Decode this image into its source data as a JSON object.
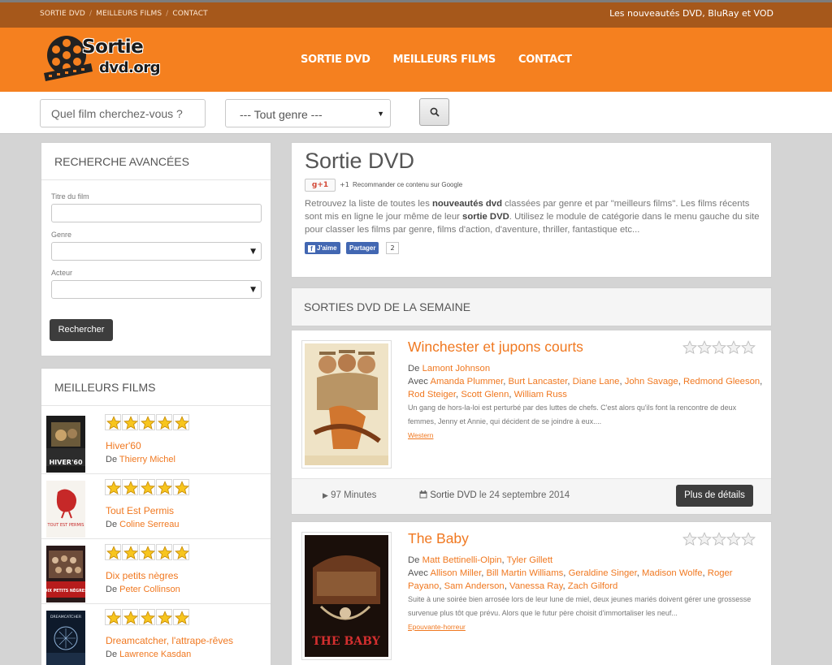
{
  "topbar": {
    "crumbs": [
      "SORTIE DVD",
      "MEILLEURS FILMS",
      "CONTACT"
    ],
    "tagline": "Les nouveautés DVD, BluRay et VOD"
  },
  "logo": {
    "line1": "Sortie",
    "line2": "dvd.org"
  },
  "nav": [
    "SORTIE DVD",
    "MEILLEURS FILMS",
    "CONTACT"
  ],
  "search": {
    "placeholder": "Quel film cherchez-vous ?",
    "genre_value": "--- Tout genre ---"
  },
  "advanced": {
    "title": "RECHERCHE AVANCÉES",
    "title_label": "Titre du film",
    "genre_label": "Genre",
    "actor_label": "Acteur",
    "submit": "Rechercher"
  },
  "best": {
    "title": "MEILLEURS FILMS",
    "items": [
      {
        "title": "Hiver'60",
        "by": "De",
        "director": "Thierry Michel",
        "rating": 5,
        "poster_text": "HIVER'60"
      },
      {
        "title": "Tout Est Permis",
        "by": "De",
        "director": "Coline Serreau",
        "rating": 5,
        "poster_text": "TOUT EST PERMIS"
      },
      {
        "title": "Dix petits nègres",
        "by": "De",
        "director": "Peter Collinson",
        "rating": 5,
        "poster_text": "DIX PETITS NÈGRES"
      },
      {
        "title": "Dreamcatcher, l'attrape-rêves",
        "by": "De",
        "director": "Lawrence Kasdan",
        "rating": 5,
        "poster_text": "DREAMCATCHER"
      }
    ]
  },
  "intro": {
    "title": "Sortie DVD",
    "gplus": "g+1",
    "gplus_count": "+1",
    "gplus_text": "Recommander ce contenu sur Google",
    "text_1": "Retrouvez la liste de toutes les ",
    "text_bold_1": "nouveautés dvd",
    "text_2": " classées par genre et par \"meilleurs films\". Les films récents sont mis en ligne le jour même de leur ",
    "text_bold_2": "sortie DVD",
    "text_3": ". Utilisez le module de catégorie dans le menu gauche du site pour classer les films par genre, films d'action, d'aventure, thriller, fantastique etc...",
    "fb_like": "J'aime",
    "fb_share": "Partager",
    "fb_count": "2"
  },
  "week": {
    "title": "SORTIES DVD DE LA SEMAINE"
  },
  "films": [
    {
      "title": "Winchester et jupons courts",
      "de": "De",
      "directors": [
        "Lamont Johnson"
      ],
      "avec": "Avec",
      "actors": [
        "Amanda Plummer",
        "Burt Lancaster",
        "Diane Lane",
        "John Savage",
        "Redmond Gleeson",
        "Rod Steiger",
        "Scott Glenn",
        "William Russ"
      ],
      "synopsis": "Un gang de hors-la-loi est perturbé par des luttes de chefs. C'est alors qu'ils font la rencontre de deux femmes, Jenny et Annie, qui décident de se joindre à eux....",
      "genre": "Western",
      "duration": "97 Minutes",
      "release_label": "Sortie DVD",
      "release_date": " le 24 septembre 2014",
      "more": "Plus de détails",
      "rating": 0
    },
    {
      "title": "The Baby",
      "de": "De",
      "directors": [
        "Matt Bettinelli-Olpin",
        "Tyler Gillett"
      ],
      "avec": "Avec",
      "actors": [
        "Allison Miller",
        "Bill Martin Williams",
        "Geraldine Singer",
        "Madison Wolfe",
        "Roger Payano",
        "Sam Anderson",
        "Vanessa Ray",
        "Zach Gilford"
      ],
      "synopsis": "Suite à une soirée bien arrosée lors de leur lune de miel, deux jeunes mariés doivent gérer une grossesse survenue plus tôt que prévu. Alors que le futur père choisit d'immortaliser les neuf...",
      "genre": "Epouvante-horreur",
      "poster_text": "THE BABY",
      "rating": 0
    }
  ],
  "colors": {
    "orange": "#f5801f",
    "brown": "#a6581b",
    "link": "#f07820",
    "star": "#f7c51e"
  }
}
